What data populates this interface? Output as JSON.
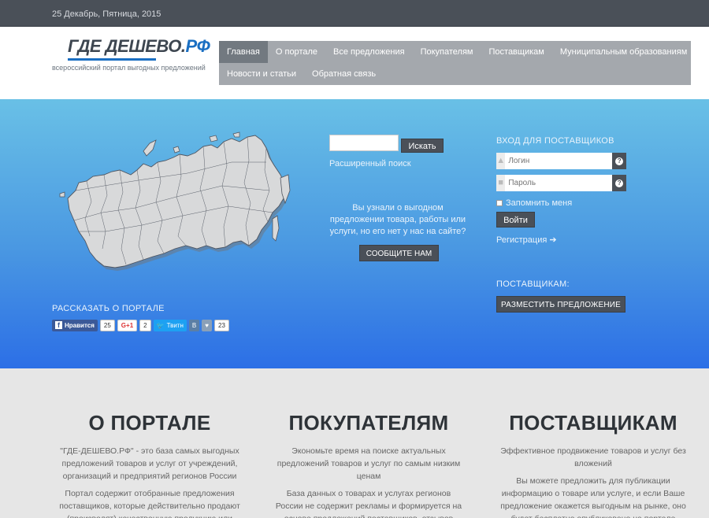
{
  "topbar": {
    "date": "25 Декабрь, Пятница, 2015"
  },
  "logo": {
    "main_prefix": "ГДЕ ДЕШЕВО.",
    "main_suffix": "РФ",
    "subtitle": "всероссийский портал выгодных предложений"
  },
  "nav": {
    "row1": [
      "Главная",
      "О портале",
      "Все предложения",
      "Покупателям",
      "Поставщикам",
      "Муниципальным образованиям"
    ],
    "row2": [
      "Новости и статьи",
      "Обратная связь"
    ]
  },
  "search": {
    "button": "Искать",
    "advanced": "Расширенный поиск"
  },
  "tell": {
    "text": "Вы узнали о выгодном предложении товара, работы или услуги, но его нет у нас на сайте?",
    "button": "СООБЩИТЕ НАМ"
  },
  "login": {
    "title": "ВХОД ДЛЯ ПОСТАВЩИКОВ",
    "login_placeholder": "Логин",
    "password_placeholder": "Пароль",
    "remember": "Запомнить меня",
    "button": "Войти",
    "register": "Регистрация ➔"
  },
  "suppliers": {
    "title": "ПОСТАВЩИКАМ:",
    "button": "РАЗМЕСТИТЬ ПРЕДЛОЖЕНИЕ"
  },
  "share": {
    "title": "РАССКАЗАТЬ О ПОРТАЛЕ",
    "fb_label": "Нравится",
    "fb_count": "25",
    "gp_label": "G+1",
    "gp_count": "2",
    "tw_label": "Твитн",
    "vk_label": "В",
    "heart_count": "23"
  },
  "columns": [
    {
      "title": "О ПОРТАЛЕ",
      "p1": "\"ГДЕ-ДЕШЕВО.РФ\" - это база самых выгодных предложений товаров и услуг от учреждений, организаций и предприятий регионов России",
      "p2": "Портал содержит отобранные предложения поставщиков, которые действительно продают (производят) качественную продукцию или"
    },
    {
      "title": "ПОКУПАТЕЛЯМ",
      "p1": "Экономьте время на поиске актуальных предложений товаров и услуг по самым низким ценам",
      "p2": "База данных о товарах и услугах регионов России не содержит рекламы и формируется на основе предложений поставщиков, отзывов покупателей и"
    },
    {
      "title": "ПОСТАВЩИКАМ",
      "p1": "Эффективное продвижение товаров и услуг без вложений",
      "p2": "Вы можете предложить для публикации информацию о товаре или услуге, и если Ваше предложение окажется выгодным на рынке, оно будет бесплатно опубликовано на портале"
    }
  ]
}
